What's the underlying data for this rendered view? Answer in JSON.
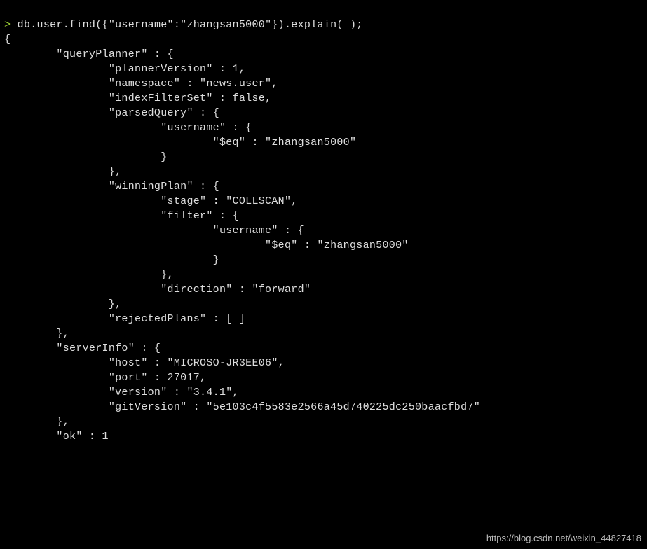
{
  "prompt_symbol": ">",
  "command": " db.user.find({\"username\":\"zhangsan5000\"}).explain( );",
  "output_lines": [
    "{",
    "        \"queryPlanner\" : {",
    "                \"plannerVersion\" : 1,",
    "                \"namespace\" : \"news.user\",",
    "                \"indexFilterSet\" : false,",
    "                \"parsedQuery\" : {",
    "                        \"username\" : {",
    "                                \"$eq\" : \"zhangsan5000\"",
    "                        }",
    "                },",
    "                \"winningPlan\" : {",
    "                        \"stage\" : \"COLLSCAN\",",
    "                        \"filter\" : {",
    "                                \"username\" : {",
    "                                        \"$eq\" : \"zhangsan5000\"",
    "                                }",
    "                        },",
    "                        \"direction\" : \"forward\"",
    "                },",
    "                \"rejectedPlans\" : [ ]",
    "        },",
    "        \"serverInfo\" : {",
    "                \"host\" : \"MICROSO-JR3EE06\",",
    "                \"port\" : 27017,",
    "                \"version\" : \"3.4.1\",",
    "                \"gitVersion\" : \"5e103c4f5583e2566a45d740225dc250baacfbd7\"",
    "        },",
    "        \"ok\" : 1"
  ],
  "watermark": "https://blog.csdn.net/weixin_44827418",
  "explain_result": {
    "queryPlanner": {
      "plannerVersion": 1,
      "namespace": "news.user",
      "indexFilterSet": false,
      "parsedQuery": {
        "username": {
          "$eq": "zhangsan5000"
        }
      },
      "winningPlan": {
        "stage": "COLLSCAN",
        "filter": {
          "username": {
            "$eq": "zhangsan5000"
          }
        },
        "direction": "forward"
      },
      "rejectedPlans": []
    },
    "serverInfo": {
      "host": "MICROSO-JR3EE06",
      "port": 27017,
      "version": "3.4.1",
      "gitVersion": "5e103c4f5583e2566a45d740225dc250baacfbd7"
    },
    "ok": 1
  }
}
